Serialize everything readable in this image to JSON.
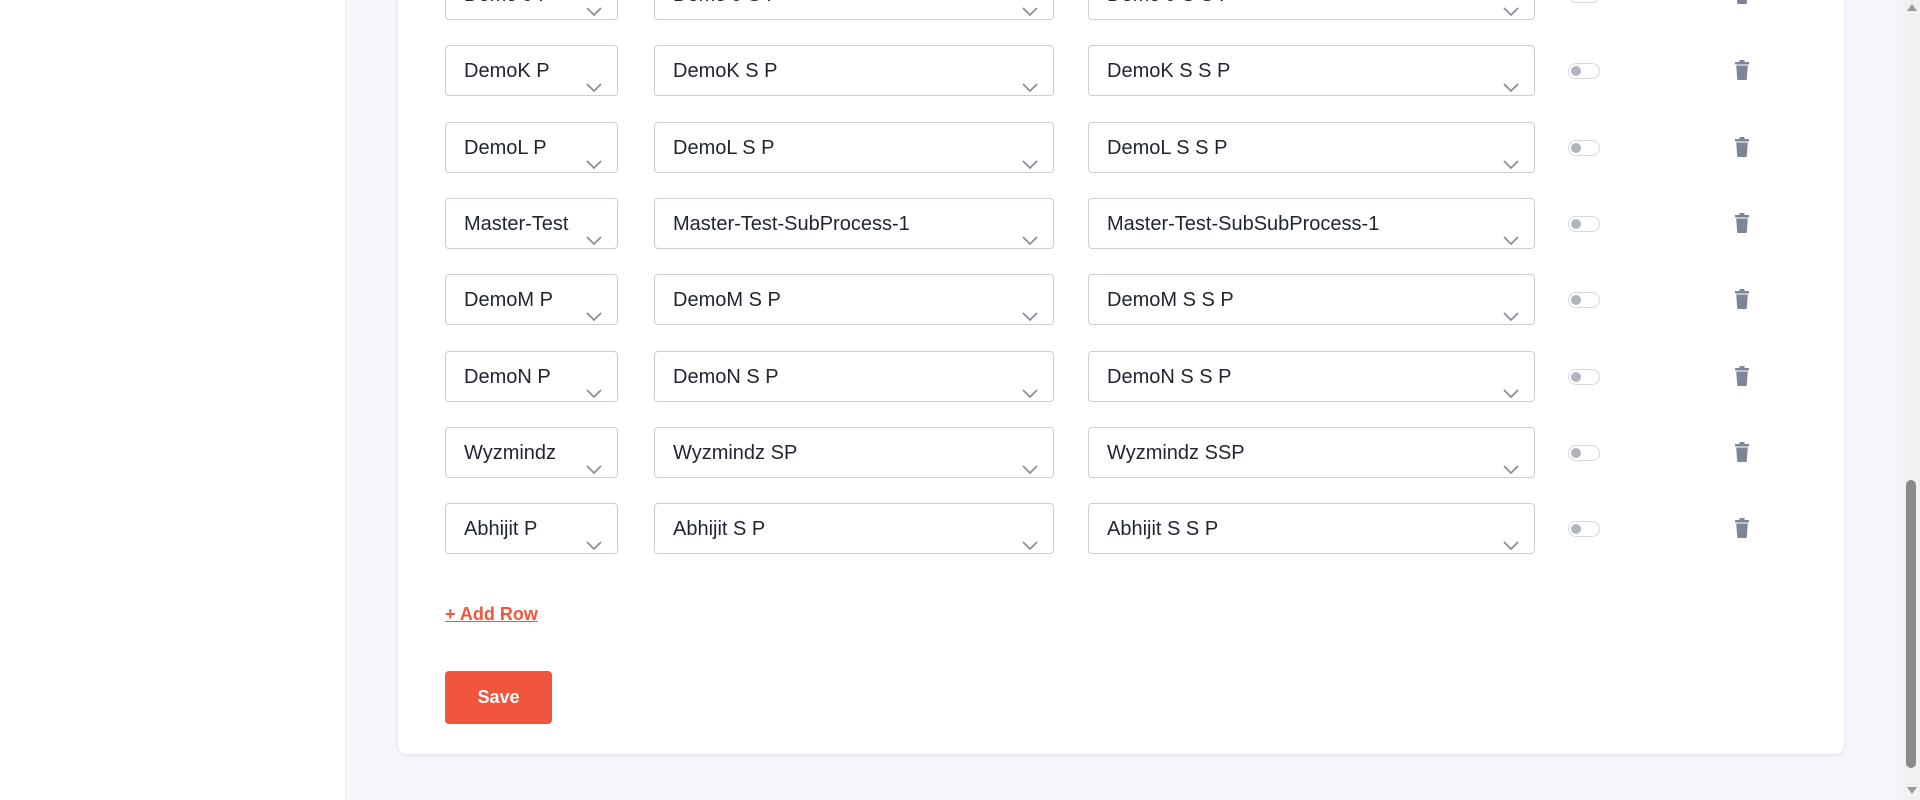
{
  "rows": [
    {
      "process": "Demo J P",
      "subprocess": "Demo J S P",
      "subsubprocess": "Demo J S S P"
    },
    {
      "process": "DemoK P",
      "subprocess": "DemoK S P",
      "subsubprocess": "DemoK S S P"
    },
    {
      "process": "DemoL P",
      "subprocess": "DemoL S P",
      "subsubprocess": "DemoL S S P"
    },
    {
      "process": "Master-Test",
      "subprocess": "Master-Test-SubProcess-1",
      "subsubprocess": "Master-Test-SubSubProcess-1"
    },
    {
      "process": "DemoM P",
      "subprocess": "DemoM S P",
      "subsubprocess": "DemoM S S P"
    },
    {
      "process": "DemoN P",
      "subprocess": "DemoN S P",
      "subsubprocess": "DemoN S S P"
    },
    {
      "process": "Wyzmindz",
      "subprocess": "Wyzmindz SP",
      "subsubprocess": "Wyzmindz SSP"
    },
    {
      "process": "Abhijit P",
      "subprocess": "Abhijit S P",
      "subsubprocess": "Abhijit S S P"
    }
  ],
  "add_row_label": "+ Add Row",
  "save_label": "Save",
  "colors": {
    "accent": "#f2553d",
    "toggle_off": "#b0b4bc",
    "delete_icon": "#7d8596",
    "page_bg": "#f4f6fb"
  },
  "icons": {
    "dropdown": "chevron-down-icon",
    "delete": "trash-icon"
  }
}
